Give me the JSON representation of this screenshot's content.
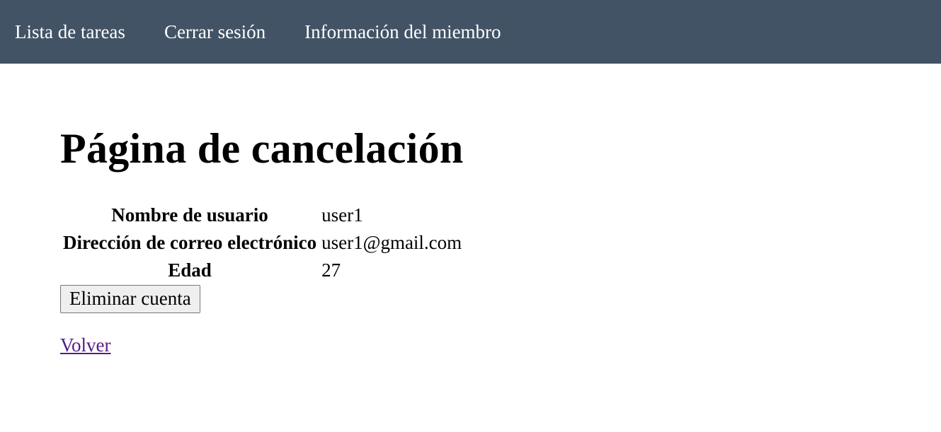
{
  "nav": {
    "items": [
      {
        "label": "Lista de tareas"
      },
      {
        "label": "Cerrar sesión"
      },
      {
        "label": "Información del miembro"
      }
    ]
  },
  "main": {
    "title": "Página de cancelación",
    "fields": [
      {
        "label": "Nombre de usuario",
        "value": "user1"
      },
      {
        "label": "Dirección de correo electrónico",
        "value": "user1@gmail.com"
      },
      {
        "label": "Edad",
        "value": "27"
      }
    ],
    "delete_button_label": "Eliminar cuenta",
    "back_link_label": "Volver"
  },
  "colors": {
    "navbar_bg": "#425365",
    "link_visited": "#551a8b"
  }
}
